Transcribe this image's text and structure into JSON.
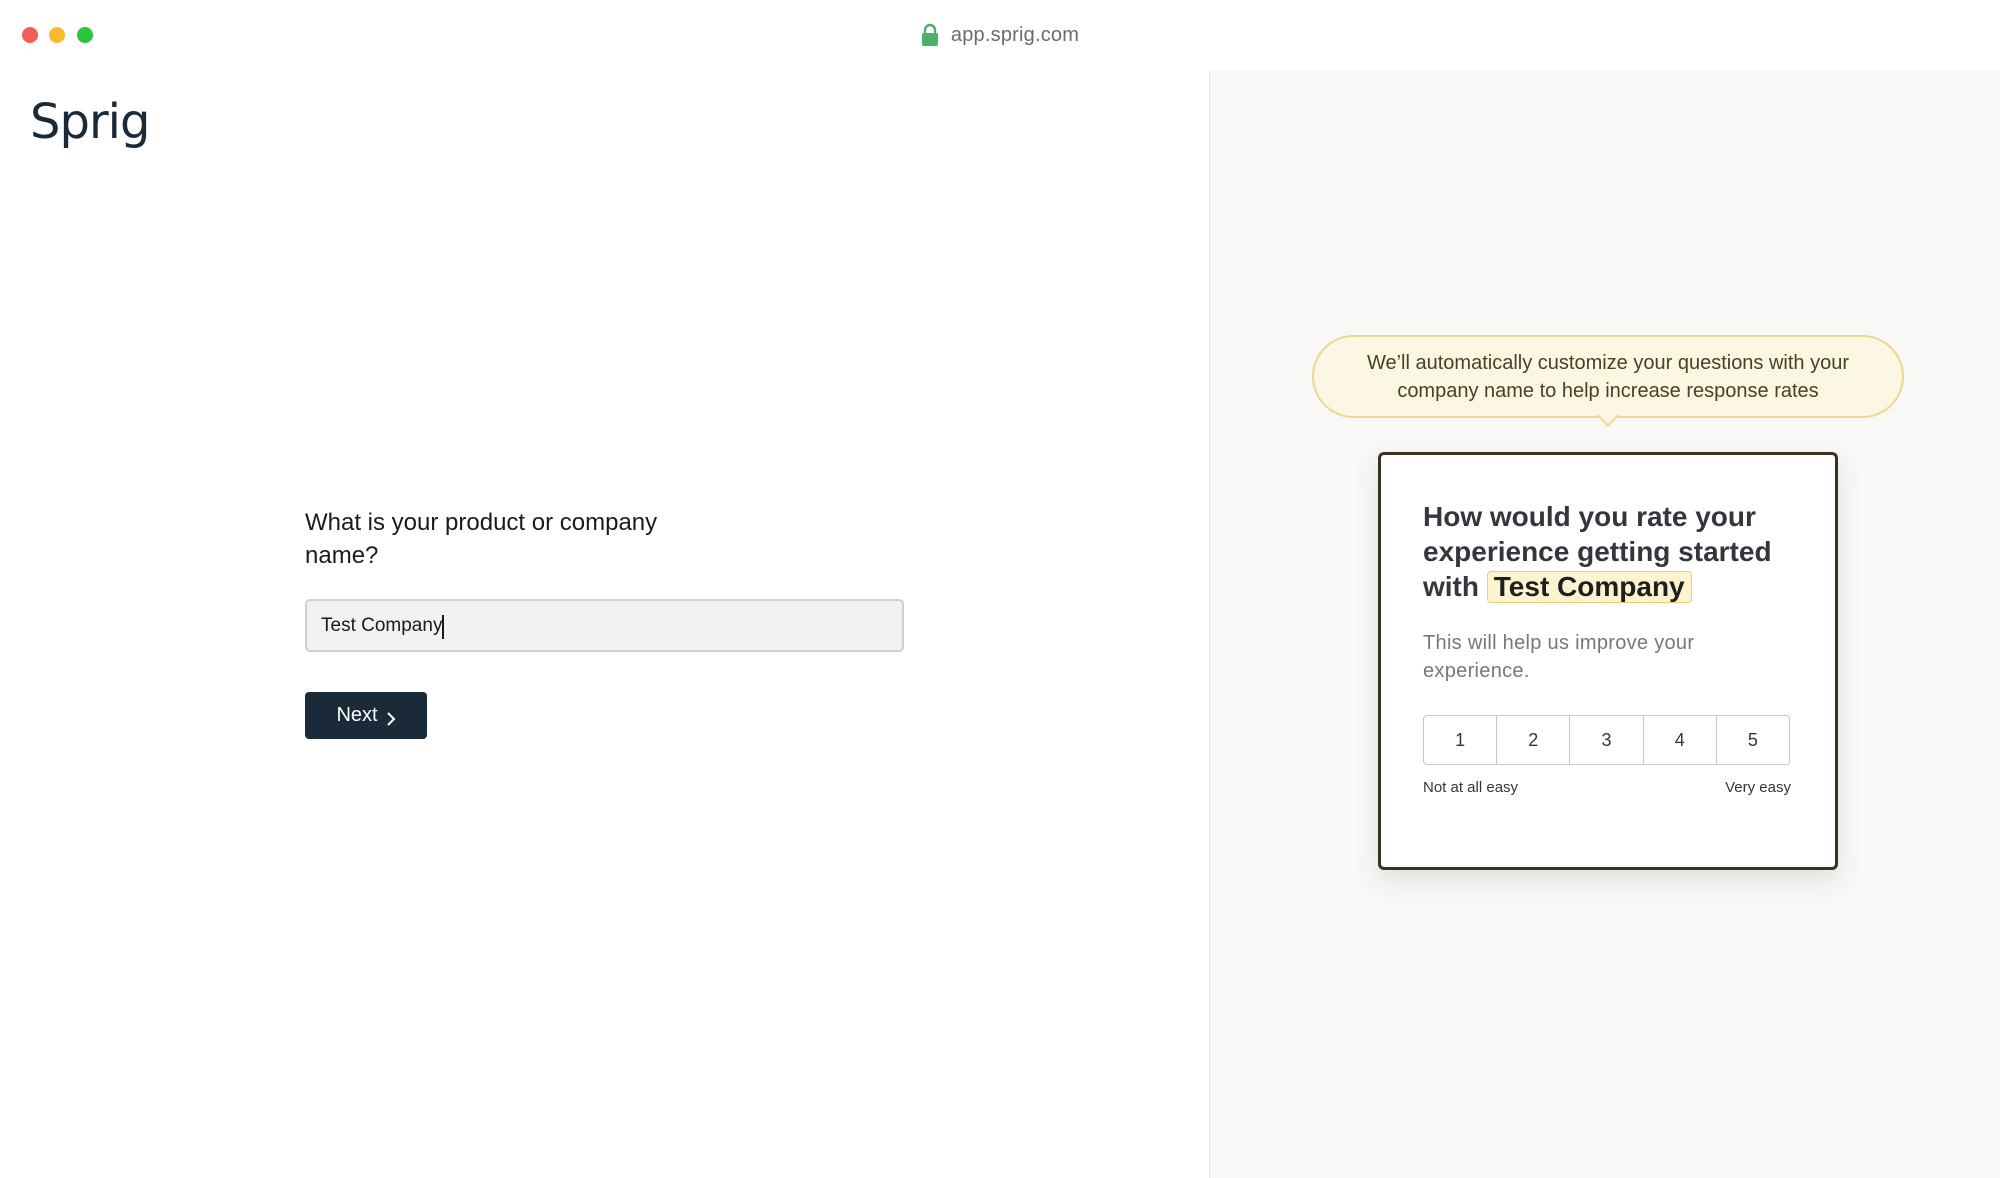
{
  "browser": {
    "url": "app.sprig.com"
  },
  "left": {
    "logo": "Sprig",
    "question": "What is your product or company name?",
    "input_value": "Test Company",
    "next_label": "Next"
  },
  "right": {
    "tooltip": "We’ll automatically customize your questions with your company name to help increase response rates",
    "card": {
      "question_prefix": "How would you rate your experience getting started with",
      "company": "Test Company",
      "subtext": "This will help us improve your experience.",
      "options": [
        "1",
        "2",
        "3",
        "4",
        "5"
      ],
      "low_label": "Not at all easy",
      "high_label": "Very easy"
    }
  },
  "colors": {
    "primary_button": "#1b2a38",
    "highlight": "#fcf3cf",
    "tooltip_border": "#ecd894"
  },
  "icons": [
    "lock-icon",
    "chevron-right-icon"
  ]
}
